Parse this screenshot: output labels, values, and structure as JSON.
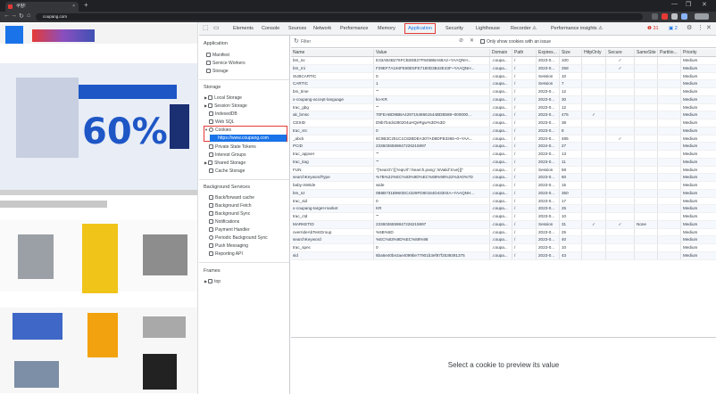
{
  "browser": {
    "tab_title": "쿠팡!",
    "url": "coupang.com",
    "new_tab": "+",
    "window_controls": [
      "—",
      "❐",
      "✕"
    ],
    "nav": [
      "←",
      "→",
      "↻",
      "⌂"
    ],
    "tab_close": "×"
  },
  "devtools": {
    "tabs": [
      "Elements",
      "Console",
      "Sources",
      "Network",
      "Performance",
      "Memory",
      "Application",
      "Security",
      "Lighthouse",
      "Recorder ⚠",
      "Performance insights ⚠"
    ],
    "active_tab": "Application",
    "errors": "❶ 31",
    "warnings": "▣ 2",
    "sidebar": {
      "application_header": "Application",
      "application_items": [
        "Manifest",
        "Service Workers",
        "Storage"
      ],
      "storage_header": "Storage",
      "storage_items": [
        "Local Storage",
        "Session Storage",
        "IndexedDB",
        "Web SQL",
        "Cookies"
      ],
      "cookie_origin": "https://www.coupang.com",
      "storage_items_after": [
        "Private State Tokens",
        "Interest Groups",
        "Shared Storage",
        "Cache Storage"
      ],
      "background_header": "Background Services",
      "background_items": [
        "Back/forward cache",
        "Background Fetch",
        "Background Sync",
        "Notifications",
        "Payment Handler",
        "Periodic Background Sync",
        "Push Messaging",
        "Reporting API"
      ],
      "frames_header": "Frames",
      "frames_items": [
        "top"
      ]
    },
    "filter": {
      "placeholder": "Filter",
      "only_issue_label": "Only show cookies with an issue"
    },
    "columns": [
      "Name",
      "Value",
      "Domain",
      "Path",
      "Expires...",
      "Size",
      "HttpOnly",
      "Secure",
      "SameSite",
      "Partitio...",
      "Priority"
    ],
    "rows": [
      [
        "bm_sv",
        "E33AB4B276FCB2EB27F845BBA68A2~YAAQNH...",
        ".coupa...",
        "/",
        "2023-0...",
        "100",
        "",
        "✓",
        "",
        "",
        "Medium"
      ],
      [
        "bm_mi",
        "F29EF7A194FE80E5FE7180D3B42E43F~YAAQNH...",
        ".coupa...",
        "/",
        "2023-0...",
        "258",
        "",
        "✓",
        "",
        "",
        "Medium"
      ],
      [
        "SUBCARTIC",
        "0",
        ".coupa...",
        "/",
        "Session",
        "10",
        "",
        "",
        "",
        "",
        "Medium"
      ],
      [
        "CARTIC",
        "1",
        ".coupa...",
        "/",
        "Session",
        "7",
        "",
        "",
        "",
        "",
        "Medium"
      ],
      [
        "bm_time",
        "\"\"",
        ".coupa...",
        "/",
        "2023-0...",
        "12",
        "",
        "",
        "",
        "",
        "Medium"
      ],
      [
        "x-coupang-accept-language",
        "ko-KR",
        ".coupa...",
        "/",
        "2023-0...",
        "30",
        "",
        "",
        "",
        "",
        "Medium"
      ],
      [
        "trac_gbg",
        "\"\"",
        ".coupa...",
        "/",
        "2023-0...",
        "12",
        "",
        "",
        "",
        "",
        "Medium"
      ],
      [
        "ak_bmsc",
        "70FEABD9BBA42971548661544BDB588~000000...",
        ".coupa...",
        "/",
        "2023-0...",
        "475",
        "✓",
        "",
        "",
        "",
        "Medium"
      ],
      [
        "CESID",
        "D9b7b4d4290204uHQeRgw%3D%3D",
        ".coupa...",
        "/",
        "2023-0...",
        "38",
        "",
        "",
        "",
        "",
        "Medium"
      ],
      [
        "trac_src",
        "0",
        ".coupa...",
        "/",
        "2023-0...",
        "8",
        "",
        "",
        "",
        "",
        "Medium"
      ],
      [
        "_abck",
        "6C9B3C251C1C82BDEA307AD8DFB3366~0~YAA...",
        ".coupa...",
        "/",
        "2024-0...",
        "485",
        "",
        "✓",
        "",
        "",
        "Medium"
      ],
      [
        "PCID",
        "2336036559847226215897",
        ".coupa...",
        "/",
        "2024-0...",
        "27",
        "",
        "",
        "",
        "",
        "Medium"
      ],
      [
        "trac_appver",
        "\"\"",
        ".coupa...",
        "/",
        "2023-0...",
        "13",
        "",
        "",
        "",
        "",
        "Medium"
      ],
      [
        "trac_itag",
        "\"\"",
        ".coupa...",
        "/",
        "2023-0...",
        "11",
        "",
        "",
        "",
        "",
        "Medium"
      ],
      [
        "FUN",
        "\"{'search':[{'reqUrl':'/search.pang','isValid':true}]}\"",
        ".coupa...",
        "/",
        "Session",
        "58",
        "",
        "",
        "",
        "",
        "Medium"
      ],
      [
        "searchKeywordType",
        "%7B%22%EC%83%9D%EC%88%98%22%3A0%7D",
        ".coupa...",
        "/",
        "2023-0...",
        "60",
        "",
        "",
        "",
        "",
        "Medium"
      ],
      [
        "baby-isWide",
        "wide",
        ".coupa...",
        "/",
        "2023-0...",
        "15",
        "",
        "",
        "",
        "",
        "Medium"
      ],
      [
        "bm_sz",
        "0B8B731B960DC4329FD80154D43304A~YAAQNH...",
        ".coupa...",
        "/",
        "2023-0...",
        "350",
        "",
        "",
        "",
        "",
        "Medium"
      ],
      [
        "trac_sid",
        "0",
        ".coupa...",
        "/",
        "2023-0...",
        "17",
        "",
        "",
        "",
        "",
        "Medium"
      ],
      [
        "x-coupang-target-market",
        "KR",
        ".coupa...",
        "/",
        "2023-0...",
        "25",
        "",
        "",
        "",
        "",
        "Medium"
      ],
      [
        "trac_ctd",
        "\"\"",
        ".coupa...",
        "/",
        "2023-0...",
        "10",
        "",
        "",
        "",
        "",
        "Medium"
      ],
      [
        "MARKETID",
        "2336036559847226215897",
        ".coupa...",
        "/",
        "Session",
        "31",
        "✓",
        "✓",
        "None",
        "",
        "Medium"
      ],
      [
        "overrideAbTestGroup",
        "%5B%5D",
        ".coupa...",
        "/",
        "2023-0...",
        "25",
        "",
        "",
        "",
        "",
        "Medium"
      ],
      [
        "searchKeyword",
        "%EC%83%9D%EC%88%98",
        ".coupa...",
        "/",
        "2023-0...",
        "40",
        "",
        "",
        "",
        "",
        "Medium"
      ],
      [
        "trac_spec",
        "0",
        ".coupa...",
        "/",
        "2023-0...",
        "10",
        "",
        "",
        "",
        "",
        "Medium"
      ],
      [
        "sid",
        "6ba6e40be2ae4099be77901b3ef87f2539391375",
        ".coupa...",
        "/",
        "2023-0...",
        "43",
        "",
        "",
        "",
        "",
        "Medium"
      ]
    ],
    "preview_text": "Select a cookie to preview its value"
  },
  "page": {
    "banner_text": "60%",
    "accent": "#1a73e8",
    "highlight": "#e53935"
  }
}
